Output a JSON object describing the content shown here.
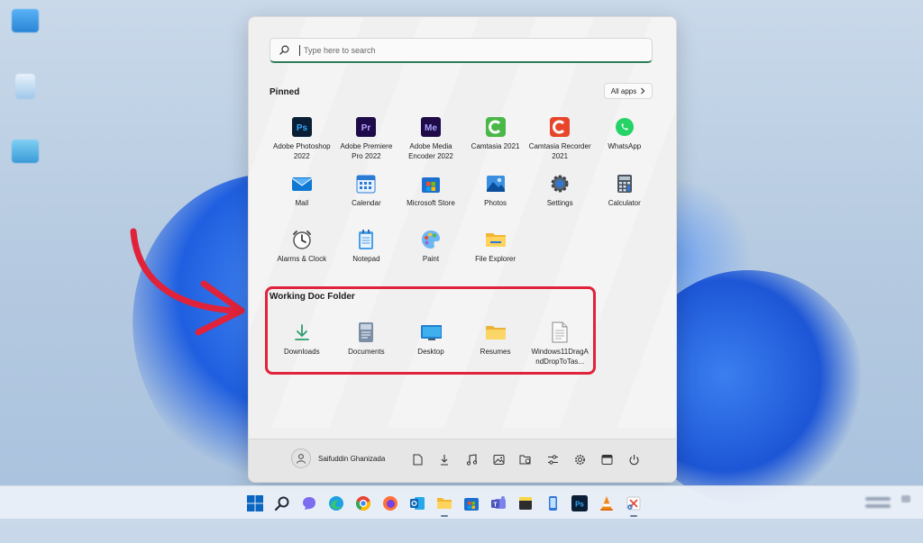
{
  "search": {
    "placeholder": "Type here to search"
  },
  "pinned": {
    "title": "Pinned",
    "all_apps_label": "All apps",
    "apps": [
      {
        "label": "Adobe Photoshop 2022",
        "icon": "photoshop-icon"
      },
      {
        "label": "Adobe Premiere Pro 2022",
        "icon": "premiere-icon"
      },
      {
        "label": "Adobe Media Encoder 2022",
        "icon": "media-encoder-icon"
      },
      {
        "label": "Camtasia 2021",
        "icon": "camtasia-icon"
      },
      {
        "label": "Camtasia Recorder 2021",
        "icon": "camtasia-recorder-icon"
      },
      {
        "label": "WhatsApp",
        "icon": "whatsapp-icon"
      },
      {
        "label": "Mail",
        "icon": "mail-icon"
      },
      {
        "label": "Calendar",
        "icon": "calendar-icon"
      },
      {
        "label": "Microsoft Store",
        "icon": "store-icon"
      },
      {
        "label": "Photos",
        "icon": "photos-icon"
      },
      {
        "label": "Settings",
        "icon": "settings-icon"
      },
      {
        "label": "Calculator",
        "icon": "calculator-icon"
      },
      {
        "label": "Alarms & Clock",
        "icon": "alarm-clock-icon"
      },
      {
        "label": "Notepad",
        "icon": "notepad-icon"
      },
      {
        "label": "Paint",
        "icon": "paint-icon"
      },
      {
        "label": "File Explorer",
        "icon": "file-explorer-icon"
      }
    ]
  },
  "folder": {
    "title": "Working Doc Folder",
    "items": [
      {
        "label": "Downloads",
        "icon": "download-icon"
      },
      {
        "label": "Documents",
        "icon": "documents-icon"
      },
      {
        "label": "Desktop",
        "icon": "desktop-icon"
      },
      {
        "label": "Resumes",
        "icon": "folder-icon"
      },
      {
        "label": "Windows11DragAndDropToTas...",
        "icon": "file-icon"
      }
    ]
  },
  "footer": {
    "user_name": "Saifuddin Ghanizada"
  },
  "colors": {
    "highlight": "#e0233a",
    "search_accent": "#2d7d5a",
    "windows_blue": "#0a66c2"
  }
}
